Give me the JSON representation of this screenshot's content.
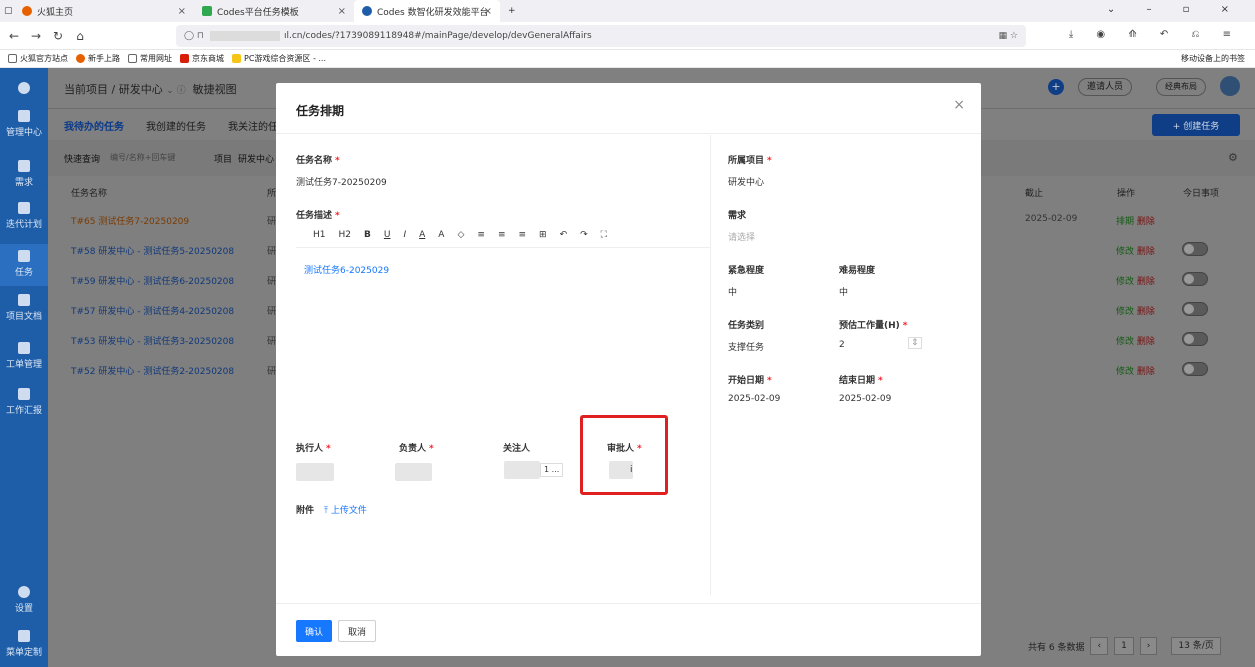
{
  "browser": {
    "tabs": [
      {
        "label": "火狐主页",
        "color": "#e66000"
      },
      {
        "label": "Codes平台任务模板",
        "color": "#2fa84f"
      },
      {
        "label": "Codes 数智化研发效能平台",
        "color": "#1e5ea8"
      }
    ],
    "url": "ıl.cn/codes/?1739089118948#/mainPage/develop/devGeneralAffairs",
    "bookmarks": [
      "火狐官方站点",
      "新手上路",
      "常用网址",
      "京东商城",
      "PC游戏综合资源区 - ..."
    ],
    "mobile_bookmarks": "移动设备上的书签"
  },
  "sidebar": {
    "items": [
      "管理中心",
      "需求",
      "迭代计划",
      "任务",
      "项目文档",
      "工单管理",
      "工作汇报",
      "设置",
      "菜单定制"
    ]
  },
  "header": {
    "crumb": "当前项目 / 研发中心",
    "view": "敏捷视图",
    "invite": "邀请人员",
    "layout": "经典布局"
  },
  "subtabs": [
    "我待办的任务",
    "我创建的任务",
    "我关注的任"
  ],
  "filter": {
    "quick": "快速查询",
    "placeholder": "编号/名称+回车键",
    "project_label": "项目",
    "project_value": "研发中心"
  },
  "create_button": "+ 创建任务",
  "table": {
    "headers": {
      "name": "任务名称",
      "short": "所",
      "deadline": "截止",
      "ops": "操作",
      "today": "今日事项"
    },
    "rows": [
      {
        "name": "T#65 测试任务7-20250209",
        "col": "研",
        "deadline": "2025-02-09",
        "op1": "排期",
        "op2": "删除"
      },
      {
        "name": "T#58 研发中心 - 测试任务5-20250208",
        "col": "研",
        "op1": "修改",
        "op2": "删除"
      },
      {
        "name": "T#59 研发中心 - 测试任务6-20250208",
        "col": "研",
        "op1": "修改",
        "op2": "删除"
      },
      {
        "name": "T#57 研发中心 - 测试任务4-20250208",
        "col": "研",
        "op1": "修改",
        "op2": "删除"
      },
      {
        "name": "T#53 研发中心 - 测试任务3-20250208",
        "col": "研",
        "op1": "修改",
        "op2": "删除"
      },
      {
        "name": "T#52 研发中心 - 测试任务2-20250208",
        "col": "研",
        "op1": "修改",
        "op2": "删除"
      }
    ]
  },
  "pager": {
    "total": "共有 6 条数据",
    "page": "1",
    "size": "13 条/页"
  },
  "modal": {
    "title": "任务排期",
    "name_label": "任务名称",
    "name_value": "测试任务7-20250209",
    "desc_label": "任务描述",
    "toolbar": [
      "H1",
      "H2",
      "B",
      "U",
      "I",
      "A",
      "A",
      "◇",
      "≡",
      "≡",
      "≡",
      "⊞",
      "↶",
      "↷",
      "⛶"
    ],
    "desc_value": "测试任务6-2025029",
    "executor_label": "执行人",
    "owner_label": "负责人",
    "follower_label": "关注人",
    "follower_more": "1 ...",
    "approver_label": "审批人",
    "approver_value": "i",
    "attach_label": "附件",
    "upload": "上传文件",
    "project_label": "所属项目",
    "project_value": "研发中心",
    "req_label": "需求",
    "req_placeholder": "请选择",
    "urgency_label": "紧急程度",
    "urgency_value": "中",
    "difficulty_label": "难易程度",
    "difficulty_value": "中",
    "category_label": "任务类别",
    "category_value": "支撑任务",
    "effort_label": "预估工作量(H)",
    "effort_value": "2",
    "start_label": "开始日期",
    "start_value": "2025-02-09",
    "end_label": "结束日期",
    "end_value": "2025-02-09",
    "ok": "确认",
    "cancel": "取消"
  }
}
